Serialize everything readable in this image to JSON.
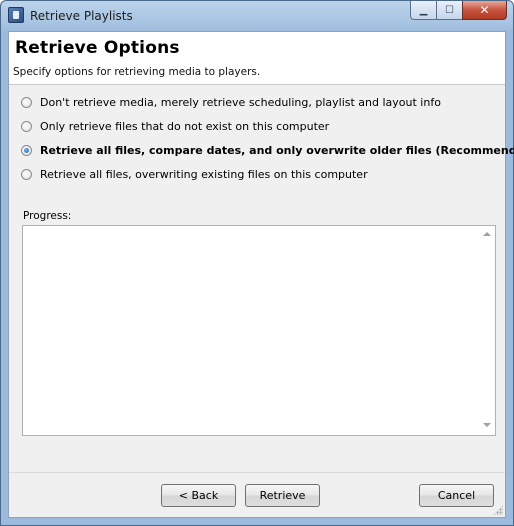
{
  "window": {
    "title": "Retrieve Playlists",
    "min_glyph": "▁",
    "max_glyph": "☐",
    "close_glyph": "✕"
  },
  "header": {
    "title": "Retrieve Options",
    "subtitle": "Specify options for retrieving media to players."
  },
  "options": [
    {
      "label": "Don't retrieve media, merely retrieve scheduling, playlist and layout info",
      "selected": false
    },
    {
      "label": "Only retrieve files that do not exist on this computer",
      "selected": false
    },
    {
      "label": "Retrieve all files, compare dates, and only overwrite older files (Recommended)",
      "selected": true
    },
    {
      "label": "Retrieve all files, overwriting existing files on this computer",
      "selected": false
    }
  ],
  "progress": {
    "label": "Progress:",
    "text": ""
  },
  "buttons": {
    "back": "< Back",
    "retrieve": "Retrieve",
    "cancel": "Cancel"
  },
  "icons": {
    "app": "app-icon",
    "scroll_up": "scroll-up-arrow-icon",
    "scroll_down": "scroll-down-arrow-icon"
  }
}
